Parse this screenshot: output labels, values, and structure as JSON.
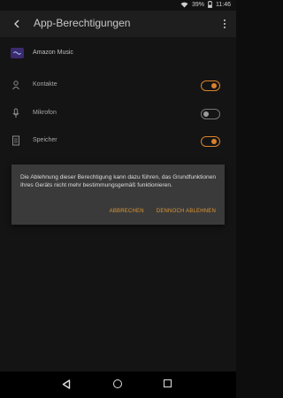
{
  "status_bar": {
    "battery_text": "39%",
    "time": "11:46"
  },
  "toolbar": {
    "title": "App-Berechtigungen",
    "back_icon": "arrow-back",
    "more_icon": "more-vert"
  },
  "app": {
    "name": "Amazon Music",
    "icon": "amazon-music-logo"
  },
  "permissions": [
    {
      "label": "Kontakte",
      "icon": "person",
      "enabled": true
    },
    {
      "label": "Mikrofon",
      "icon": "microphone",
      "enabled": false
    },
    {
      "label": "Speicher",
      "icon": "storage",
      "enabled": true
    }
  ],
  "dialog": {
    "message": "Die Ablehnung dieser Berechtigung kann dazu führen, das Grundfunktionen Ihres Geräts nicht mehr bestimmungsgemäß funktionieren.",
    "cancel_label": "ABBRECHEN",
    "confirm_label": "DENNOCH ABLEHNEN"
  },
  "colors": {
    "accent": "#d9822b",
    "toolbar": "#1e1e1e",
    "background": "#141414",
    "dialog": "#3a3a3a"
  }
}
